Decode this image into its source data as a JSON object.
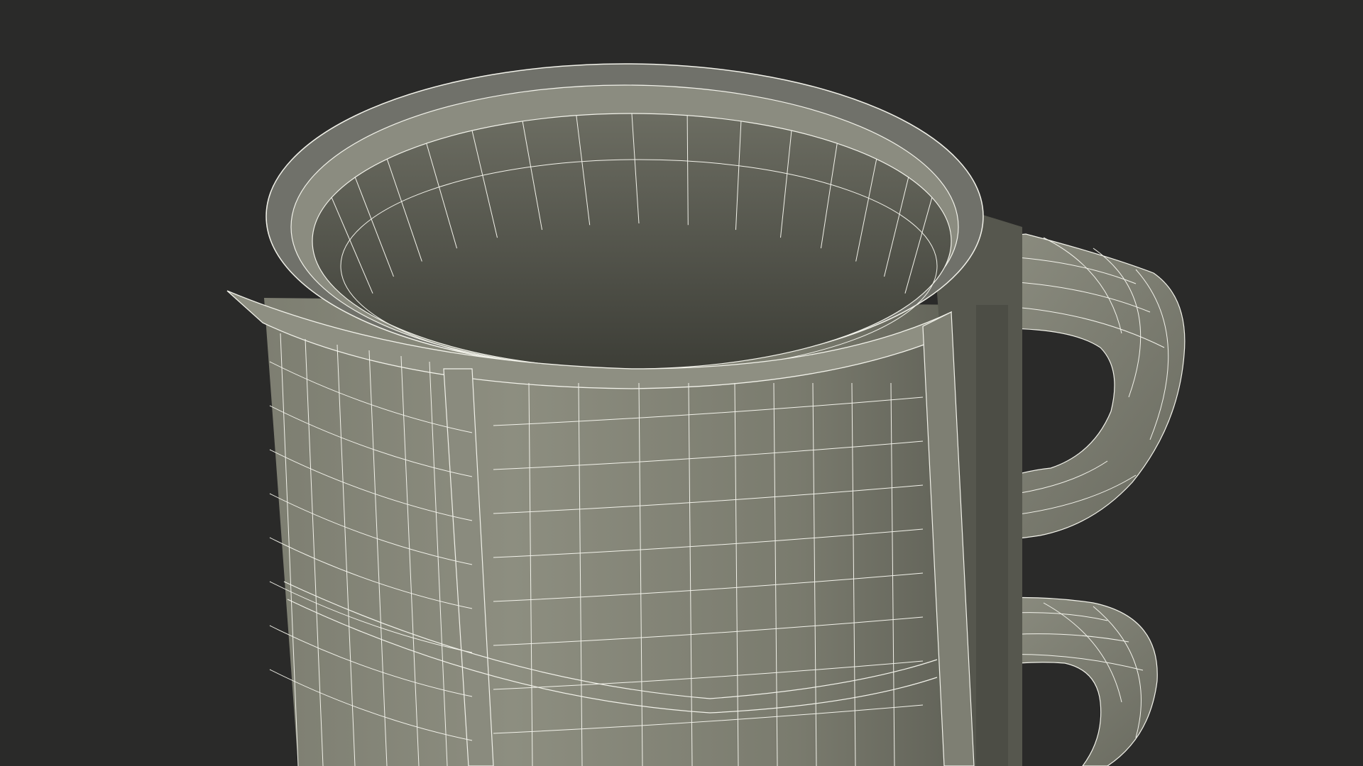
{
  "scene": {
    "kind": "3d-wireframe-render",
    "subject": "stacked-mugs",
    "background_color": "#2a2a29",
    "surface_color": "#8a8a7c",
    "surface_shadow_color": "#5e5f55",
    "interior_color": "#4a4b43",
    "wire_color": "#f2f2ea"
  }
}
